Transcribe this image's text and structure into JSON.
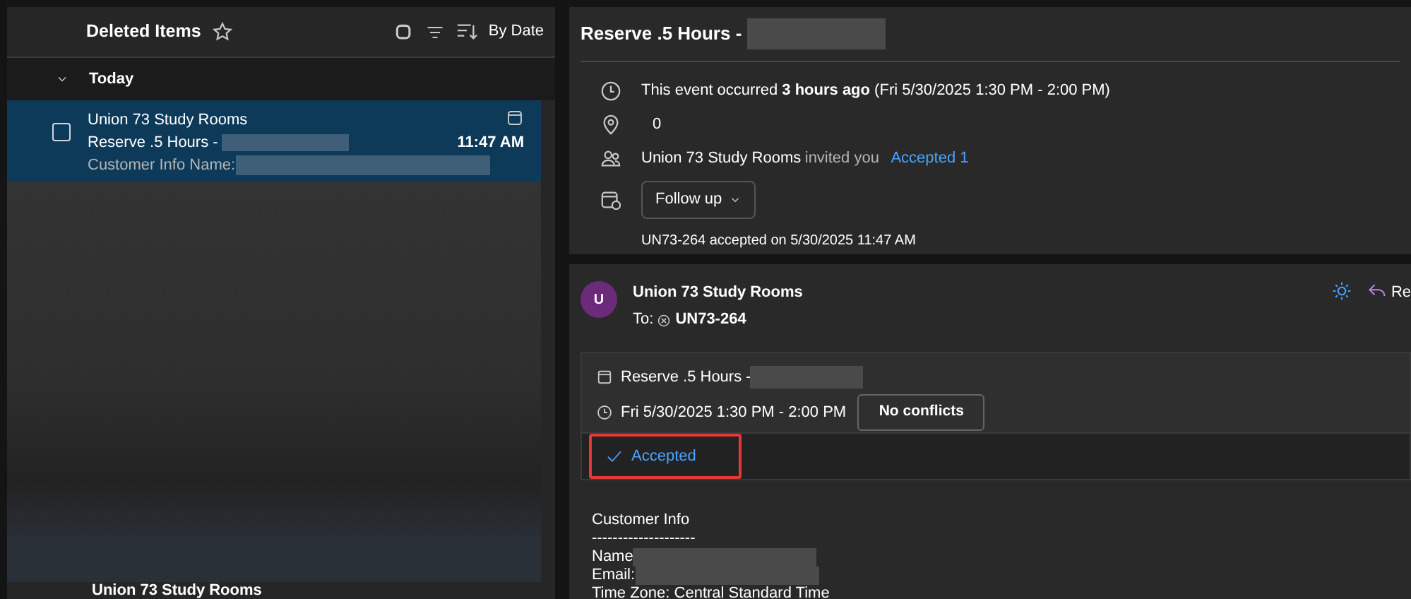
{
  "folder": {
    "title": "Deleted Items",
    "sort_label": "By Date"
  },
  "groups": [
    {
      "label": "Today",
      "expanded": true
    }
  ],
  "messages": [
    {
      "sender": "Union 73 Study Rooms",
      "subject": "Reserve .5 Hours -",
      "time": "11:47 AM",
      "preview": "Customer Info Name:",
      "selected": true,
      "checked": false
    }
  ],
  "next_message": {
    "sender": "Union 73 Study Rooms"
  },
  "event": {
    "title": "Reserve .5 Hours -",
    "when": "This event occurred **3 hours ago** (Fri 5/30/2025 1:30 PM - 2:00 PM)",
    "location": "0",
    "organizer": "Union 73 Study Rooms",
    "invited": "invited you",
    "accepted_link": "Accepted 1",
    "follow_up": "Follow up",
    "status_note": "UN73-264 accepted on 5/30/2025 11:47 AM"
  },
  "email": {
    "avatar": "U",
    "sender": "Union 73 Study Rooms",
    "to_label": "To:",
    "recipient": "UN73-264",
    "reply": "Re",
    "invite_title": "Reserve .5 Hours -",
    "invite_time": "Fri 5/30/2025 1:30 PM - 2:00 PM",
    "conflicts": "No conflicts",
    "response": "Accepted",
    "highlighted": true,
    "body": [
      "Customer Info",
      "--------------------",
      "Name",
      "Email:",
      "Time Zone: Central Standard Time"
    ]
  }
}
